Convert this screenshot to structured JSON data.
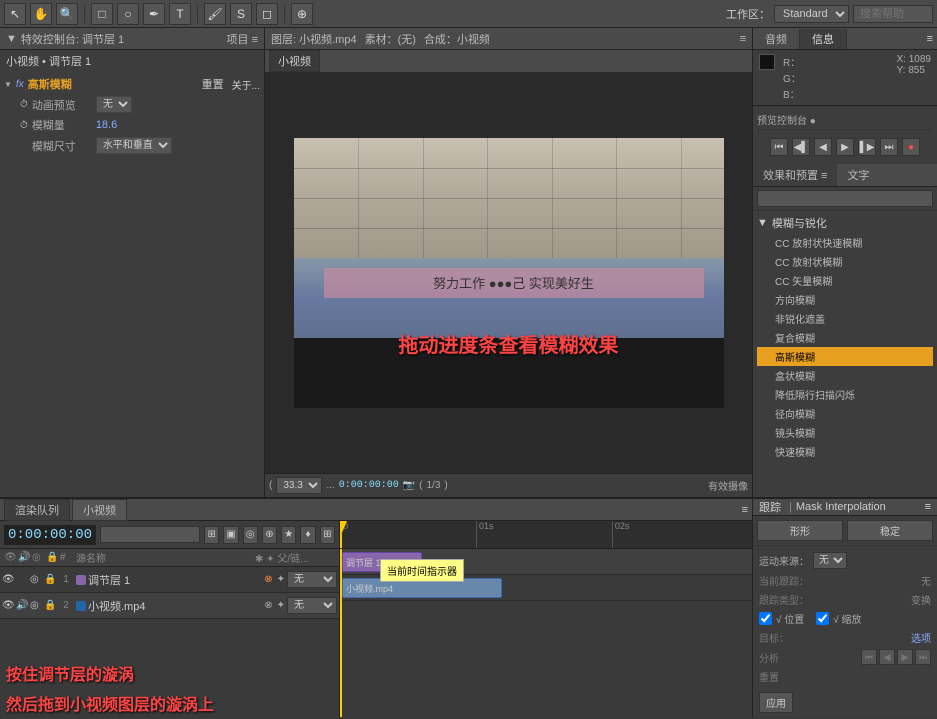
{
  "toolbar": {
    "workspace_label": "工作区：",
    "workspace_value": "Standard",
    "search_placeholder": "搜索帮助"
  },
  "left_panel": {
    "header": "特效控制台: 调节层 1",
    "header_icon": "≡",
    "project_label": "项目 ≡",
    "layer_title": "小视频 • 调节层 1",
    "effect": {
      "name": "高斯模糊",
      "reset": "重置",
      "about": "关于..."
    },
    "props": {
      "animation_preview": "动画预览",
      "animation_val": "无",
      "blur_amount_label": "模糊量",
      "blur_amount_val": "18.6",
      "blur_dimensions_label": "模糊尺寸",
      "blur_dimensions_val": "水平和垂直"
    }
  },
  "center_panel": {
    "tabs": [
      "小视频"
    ],
    "top_bar": {
      "layer_label": "图层: 小视频.mp4",
      "source_label": "素材：(无)",
      "comp_label": "合成：小视频"
    },
    "video_text": "努力工作 ●●●己 实现美好生",
    "drag_hint": "拖动进度条查看模糊效果",
    "preview_controls": {
      "time": "0:00:00:00",
      "zoom": "33.3",
      "frame_info": "1/3"
    }
  },
  "right_panel": {
    "tabs": [
      "音频",
      "信息"
    ],
    "active_tab": "信息",
    "color": {
      "r": "R：",
      "g": "G：",
      "b": "B："
    },
    "coords": {
      "x": "X: 1089",
      "y": "Y: 855"
    },
    "preview_control_title": "预览控制台 ●",
    "transport_buttons": [
      "⏮",
      "◀▐",
      "◀",
      "▶",
      "▶▐",
      "⏭",
      "●"
    ],
    "effects_tabs": [
      "效果和预置 ≡",
      "文字"
    ],
    "search_placeholder": "",
    "categories": [
      {
        "name": "模糊与锐化",
        "expanded": true,
        "items": [
          "CC 放射状快速模糊",
          "CC 放射状模糊",
          "CC 矢量模糊",
          "方向模糊",
          "非锐化遮盖",
          "复合模糊",
          "高斯模糊",
          "盒状模糊",
          "降低隔行扫描闪烁",
          "径向模糊",
          "镜头模糊",
          "快速模糊"
        ]
      }
    ]
  },
  "timeline": {
    "tabs": [
      "渲染队列",
      "小视频"
    ],
    "active_tab": "小视频",
    "timecode": "0:00:00:00",
    "ruler_marks": [
      "01s",
      "02s"
    ],
    "layers": [
      {
        "num": "1",
        "color": "#8866aa",
        "name": "调节层 1",
        "parent": "无"
      },
      {
        "num": "2",
        "color": "#2266aa",
        "name": "小视频.mp4",
        "parent": "无"
      }
    ],
    "playhead_tooltip": "当前时间指示器",
    "bottom_hint1": "按住调节层的漩涡",
    "bottom_hint2": "然后拖到小视频图层的漩涡上"
  },
  "mask_interp": {
    "title": "跟踪",
    "panel_title": "Mask Interpolation",
    "shape_label": "形形",
    "stabilize_label": "稳定",
    "motion_source_label": "运动来源：",
    "motion_source_val": "无",
    "current_track_label": "当前跟踪：",
    "current_track_val": "无",
    "track_type_label": "跟踪类型：",
    "track_type_val": "变换",
    "position_label": "√ 位置",
    "scale_label": "√ 缩放",
    "target_label": "目标：",
    "target_val": "",
    "analyze_label": "分析",
    "apply_label": "重置",
    "apply2_label": "应用",
    "buttons": [
      "选项",
      "应用"
    ]
  }
}
